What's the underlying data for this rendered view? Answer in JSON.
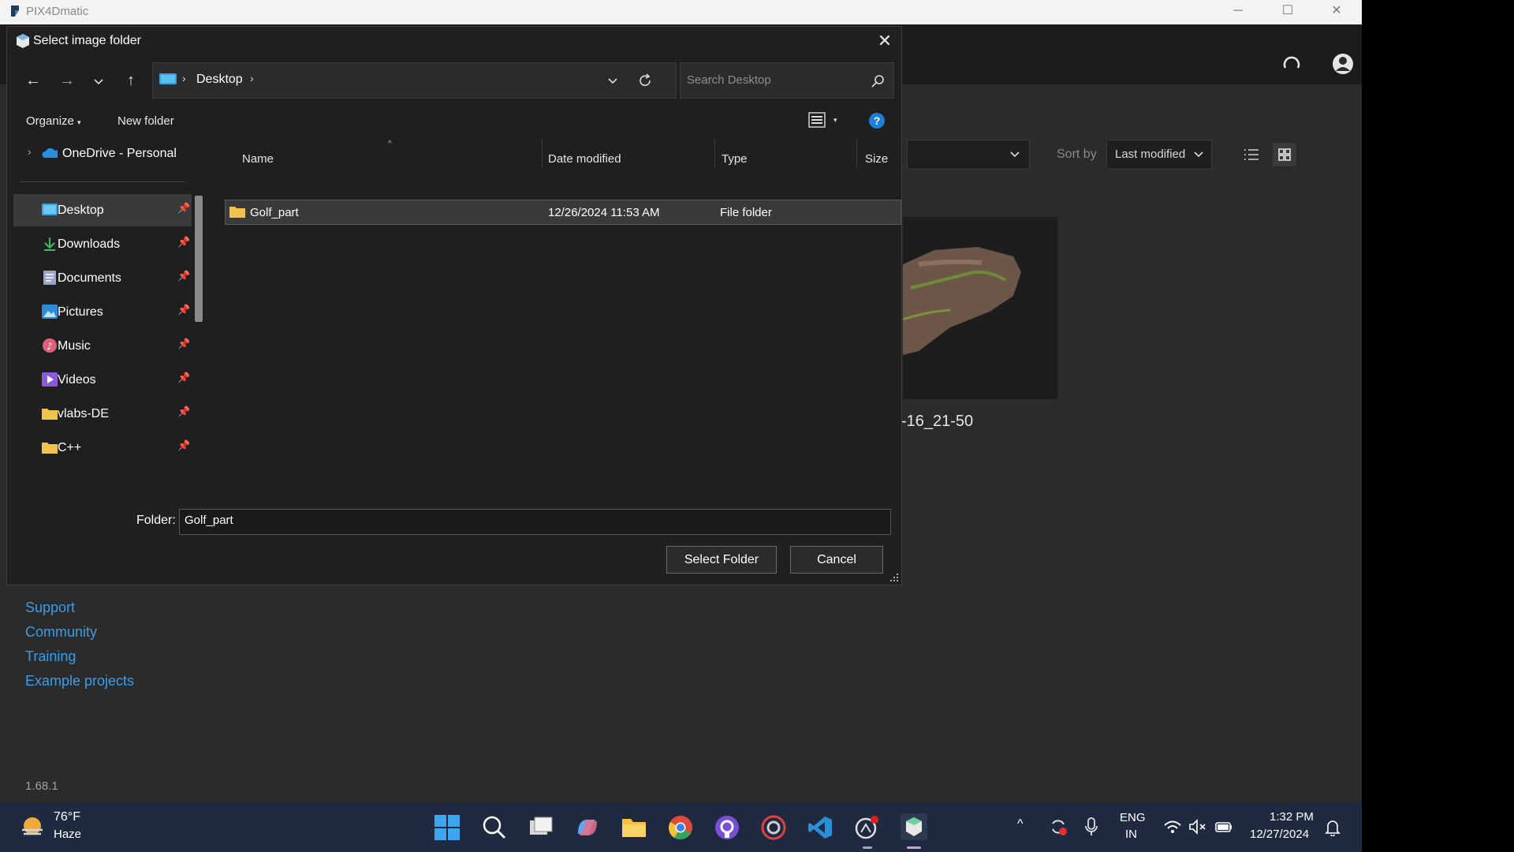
{
  "app": {
    "title": "PIX4Dmatic",
    "sort_by_label": "Sort by",
    "sort_value": "Last modified",
    "project_name": "-16_21-50",
    "links": [
      "Support",
      "Community",
      "Training",
      "Example projects"
    ],
    "version": "1.68.1"
  },
  "dialog": {
    "title": "Select image folder",
    "breadcrumb": [
      "Desktop"
    ],
    "search_placeholder": "Search Desktop",
    "toolbar": {
      "organize": "Organize",
      "new_folder": "New folder"
    },
    "sidebar": {
      "onedrive": "OneDrive - Personal",
      "items": [
        {
          "label": "Desktop",
          "icon": "desktop-icon",
          "color": "#3aa0e0"
        },
        {
          "label": "Downloads",
          "icon": "downloads-icon",
          "color": "#3dbb6a"
        },
        {
          "label": "Documents",
          "icon": "documents-icon",
          "color": "#9aa6c8"
        },
        {
          "label": "Pictures",
          "icon": "pictures-icon",
          "color": "#2f8bd8"
        },
        {
          "label": "Music",
          "icon": "music-icon",
          "color": "#e0607a"
        },
        {
          "label": "Videos",
          "icon": "videos-icon",
          "color": "#8a5ad8"
        },
        {
          "label": "vlabs-DE",
          "icon": "folder-icon",
          "color": "#f0c44c"
        },
        {
          "label": "C++",
          "icon": "folder-icon",
          "color": "#f0c44c"
        }
      ]
    },
    "columns": [
      "Name",
      "Date modified",
      "Type",
      "Size"
    ],
    "rows": [
      {
        "name": "Golf_part",
        "date": "12/26/2024 11:53 AM",
        "type": "File folder",
        "size": ""
      }
    ],
    "folder_label": "Folder:",
    "folder_value": "Golf_part",
    "select_button": "Select Folder",
    "cancel_button": "Cancel"
  },
  "taskbar": {
    "weather_temp": "76°F",
    "weather_desc": "Haze",
    "lang_top": "ENG",
    "lang_bottom": "IN",
    "time": "1:32 PM",
    "date": "12/27/2024"
  }
}
